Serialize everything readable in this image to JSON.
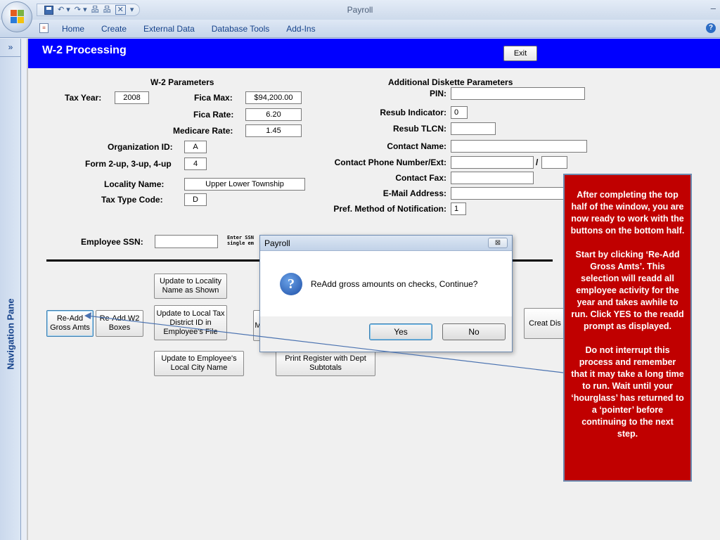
{
  "app": {
    "title": "Payroll",
    "minimize_glyph": "–"
  },
  "quick_access": [
    "save-icon",
    "undo-icon",
    "redo-icon",
    "org-chart-icon",
    "org-chart-icon",
    "close-box-icon",
    "customize-icon"
  ],
  "qat_glyphs": {
    "undo": "↶ ▾",
    "redo": "↷ ▾",
    "orgchart": "品",
    "closebox": "✕",
    "customize": "▾"
  },
  "ribbon": {
    "tabs": [
      "Home",
      "Create",
      "External Data",
      "Database Tools",
      "Add-Ins"
    ],
    "help_glyph": "?"
  },
  "nav_pane": {
    "label": "Navigation Pane",
    "collapse_glyph": "»"
  },
  "form": {
    "title": "W-2 Processing",
    "exit_label": "Exit",
    "w2_section_title": "W-2 Parameters",
    "tax_year_label": "Tax Year:",
    "tax_year": "2008",
    "fica_max_label": "Fica Max:",
    "fica_max": "$94,200.00",
    "fica_rate_label": "Fica Rate:",
    "fica_rate": "6.20",
    "medicare_rate_label": "Medicare Rate:",
    "medicare_rate": "1.45",
    "org_id_label": "Organization ID:",
    "org_id": "A",
    "form_up_label": "Form 2-up, 3-up, 4-up",
    "form_up": "4",
    "locality_name_label": "Locality Name:",
    "locality_name": "Upper Lower Township",
    "tax_type_label": "Tax Type Code:",
    "tax_type": "D",
    "diskette_section_title": "Additional Diskette Parameters",
    "pin_label": "PIN:",
    "pin": "",
    "resub_indicator_label": "Resub Indicator:",
    "resub_indicator": "0",
    "resub_tlcn_label": "Resub TLCN:",
    "resub_tlcn": "",
    "contact_name_label": "Contact Name:",
    "contact_name": "",
    "contact_phone_label": "Contact Phone Number/Ext:",
    "contact_phone": "",
    "phone_slash": "/",
    "contact_ext": "",
    "contact_fax_label": "Contact Fax:",
    "contact_fax": "",
    "email_label": "E-Mail Address:",
    "email": "",
    "pref_method_label": "Pref. Method of Notification:",
    "pref_method": "1",
    "employee_ssn_label": "Employee SSN:",
    "employee_ssn": "",
    "ssn_note_line1": "Enter SSN",
    "ssn_note_line2": "single em"
  },
  "buttons": {
    "readd_gross": "Re-Add Gross Amts",
    "readd_w2": "Re-Add W2 Boxes",
    "update_locality": "Update to Locality Name as Shown",
    "update_local_tax": "Update to Local Tax District ID in Employee's File",
    "update_city": "Update to Employee's Local City Name",
    "partial_m": "M",
    "print_register": "Print Register with Dept Subtotals",
    "create_diskette": "Creat Dis"
  },
  "dialog": {
    "title": "Payroll",
    "close_glyph": "⊠",
    "icon_glyph": "?",
    "message": "ReAdd gross amounts on checks, Continue?",
    "yes": "Yes",
    "no": "No"
  },
  "callout": {
    "para1": "After completing the top half of the window, you are now ready to work with the buttons on the bottom half.",
    "para2": "Start by clicking ‘Re-Add Gross Amts’.  This selection will readd all employee activity for the year and takes awhile to run.  Click YES to the readd prompt as displayed.",
    "para3": "Do not interrupt this process and remember that it may take a long time to run.  Wait until your ‘hourglass’ has returned to a ‘pointer’ before continuing to the next step.",
    "bg_color": "#c00000"
  },
  "colors": {
    "form_header": "#0000ff",
    "ribbon_text": "#15428b"
  }
}
